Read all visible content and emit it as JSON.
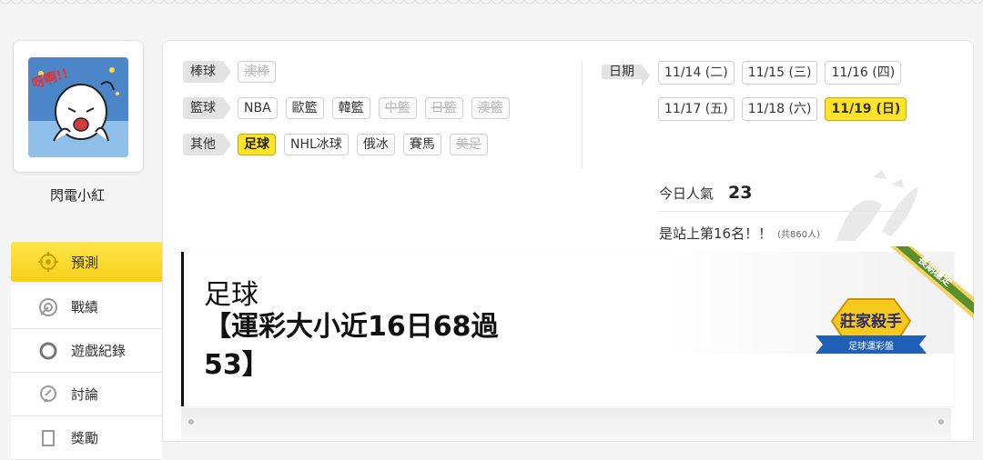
{
  "user": {
    "name": "閃電小紅",
    "avatar_caption": "呀啊!!"
  },
  "nav": [
    {
      "label": "預測",
      "icon": "target-icon",
      "active": true
    },
    {
      "label": "戰績",
      "icon": "record-icon",
      "active": false
    },
    {
      "label": "遊戲紀錄",
      "icon": "circle-icon",
      "active": false
    },
    {
      "label": "討論",
      "icon": "discussion-icon",
      "active": false
    },
    {
      "label": "獎勵",
      "icon": "reward-icon",
      "active": false
    }
  ],
  "filters": {
    "baseball": {
      "label": "棒球",
      "items": [
        {
          "label": "澳棒",
          "state": "disabled"
        }
      ]
    },
    "basketball": {
      "label": "籃球",
      "items": [
        {
          "label": "NBA",
          "state": "normal"
        },
        {
          "label": "歐籃",
          "state": "normal"
        },
        {
          "label": "韓籃",
          "state": "normal"
        },
        {
          "label": "中籃",
          "state": "disabled"
        },
        {
          "label": "日籃",
          "state": "disabled"
        },
        {
          "label": "澳籃",
          "state": "disabled"
        }
      ]
    },
    "other": {
      "label": "其他",
      "items": [
        {
          "label": "足球",
          "state": "active"
        },
        {
          "label": "NHL冰球",
          "state": "normal"
        },
        {
          "label": "俄冰",
          "state": "normal"
        },
        {
          "label": "賽馬",
          "state": "normal"
        },
        {
          "label": "美足",
          "state": "disabled"
        }
      ]
    }
  },
  "dates": {
    "label": "日期",
    "items": [
      {
        "label": "11/14 (二)",
        "active": false
      },
      {
        "label": "11/15 (三)",
        "active": false
      },
      {
        "label": "11/16 (四)",
        "active": false
      },
      {
        "label": "11/17 (五)",
        "active": false
      },
      {
        "label": "11/18 (六)",
        "active": false
      },
      {
        "label": "11/19 (日)",
        "active": true
      }
    ]
  },
  "popularity": {
    "label": "今日人氣",
    "value": "23",
    "rank_text": "是站上第16名！！",
    "total_text": "(共860人)"
  },
  "article": {
    "category": "足球",
    "title": "【運彩大小近16日68過53】",
    "ribbon_text": "長期穩定",
    "badge_title": "莊家殺手",
    "badge_subtitle": "足球運彩盤"
  },
  "colors": {
    "accent": "#ffe22a",
    "ribbon": "#5a8f2a"
  }
}
